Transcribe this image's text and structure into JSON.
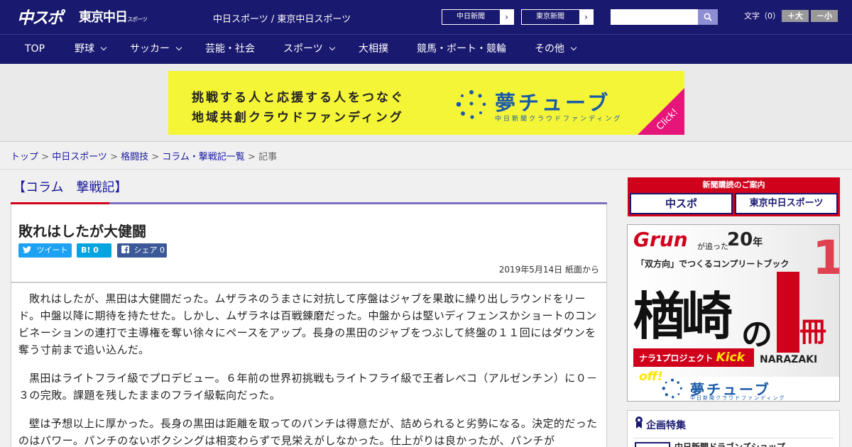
{
  "header": {
    "logo_chunichi_sports": "中スポ",
    "logo_tokyo_chunichi": "東京中日",
    "logo_tokyo_chunichi_small": "スポーツ",
    "site_name": "中日スポーツ / 東京中日スポーツ",
    "ext_links": [
      "中日新聞",
      "東京新聞"
    ],
    "ext_arrow": "›",
    "search_placeholder": "",
    "font_size_label": "文字（0）",
    "font_plus": "＋大",
    "font_minus": "－小",
    "colors": {
      "navy": "#191970",
      "accent_red": "#d0021b"
    }
  },
  "nav": {
    "items": [
      {
        "label": "TOP"
      },
      {
        "label": "野球"
      },
      {
        "label": "サッカー"
      },
      {
        "label": "芸能・社会"
      },
      {
        "label": "スポーツ"
      },
      {
        "label": "大相撲"
      },
      {
        "label": "競馬・ボート・競輪"
      },
      {
        "label": "その他"
      }
    ]
  },
  "banner": {
    "line1": "挑戦する人と応援する人をつなぐ",
    "line2": "地域共創クラウドファンディング",
    "brand": "夢チューブ",
    "brand_sub": "中日新聞クラウドファンディング",
    "click": "Click!"
  },
  "breadcrumb": {
    "items": [
      "トップ",
      "中日スポーツ",
      "格闘技",
      "コラム・撃戦記一覧"
    ],
    "current": "記事",
    "sep": " > "
  },
  "article": {
    "column_title": "【コラム　撃戦記】",
    "title": "敗れはしたが大健闘",
    "share": {
      "tweet": "ツイート",
      "hatena": "B! 0",
      "facebook": "シェア 0"
    },
    "date": "2019年5月14日 紙面から",
    "paragraphs": [
      "敗れはしたが、黒田は大健闘だった。ムザラネのうまさに対抗して序盤はジャブを果敢に繰り出しラウンドをリード。中盤以降に期待を持たせた。しかし、ムザラネは百戦錬磨だった。中盤からは堅いディフェンスかショートのコンビネーションの連打で主導権を奪い徐々にペースをアップ。長身の黒田のジャブをつぶして終盤の１１回にはダウンを奪う寸前まで追い込んだ。",
      "黒田はライトフライ級でプロデビュー。６年前の世界初挑戦もライトフライ級で王者レベコ（アルゼンチン）に０－３の完敗。課題を残したままのフライ級転向だった。",
      "壁は予想以上に厚かった。長身の黒田は距離を取ってのパンチは得意だが、詰められると劣勢になる。決定的だったのはパワー。パンチのないボクシングは相変わらずで見栄えがしなかった。仕上がりは良かったが、パンチが"
    ]
  },
  "sidebar": {
    "subscribe_title": "新聞購読のご案内",
    "subscribe_logos": [
      "中スポ",
      "東京中日スポーツ"
    ],
    "ad": {
      "grun": "Grun",
      "chasing": "が追った",
      "years": "20",
      "years_unit": "年",
      "tagline": "「双方向」でつくるコンプリートブック",
      "name": "楢崎",
      "no": "の",
      "satsu": "冊",
      "number": "1",
      "kickoff_prefix": "ナラ1プロジェクト",
      "kickoff": "Kick off!",
      "player": "NARAZAKI",
      "brand": "夢チューブ",
      "brand_sub": "中日新聞クラウドファンディング"
    },
    "feature_title": "企画特集",
    "feature_item": "中日新聞ドラゴンズショップ"
  }
}
